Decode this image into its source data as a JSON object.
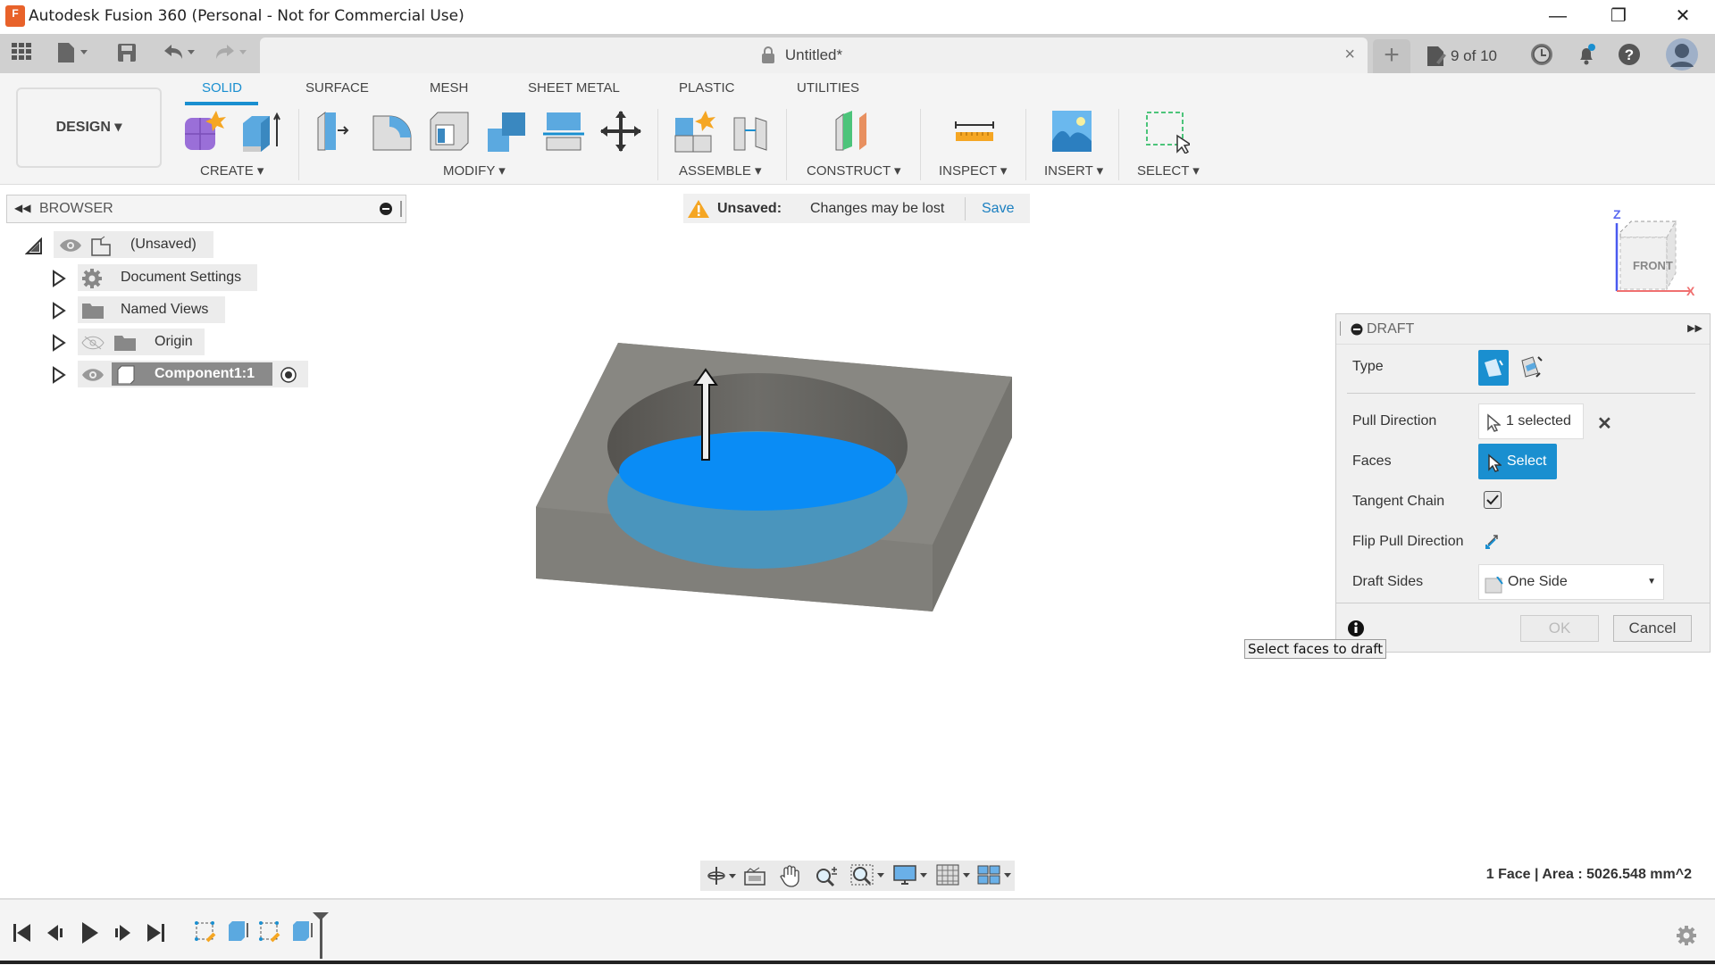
{
  "window": {
    "title": "Autodesk Fusion 360 (Personal - Not for Commercial Use)",
    "app_icon_letter": "F",
    "minimize": "—",
    "restore": "❐",
    "close": "✕"
  },
  "quick_access": {
    "document_tab_title": "Untitled*",
    "tab_close": "×",
    "new_tab": "+",
    "job_status": "9 of 10"
  },
  "ribbon": {
    "workspace": "DESIGN ▾",
    "tabs": [
      "SOLID",
      "SURFACE",
      "MESH",
      "SHEET METAL",
      "PLASTIC",
      "UTILITIES"
    ],
    "active_tab": "SOLID",
    "groups": [
      "CREATE ▾",
      "MODIFY ▾",
      "ASSEMBLE ▾",
      "CONSTRUCT ▾",
      "INSPECT ▾",
      "INSERT ▾",
      "SELECT ▾"
    ]
  },
  "browser": {
    "title": "BROWSER",
    "items": [
      {
        "label": "(Unsaved)",
        "icon": "component-root-icon"
      },
      {
        "label": "Document Settings",
        "icon": "gear-icon"
      },
      {
        "label": "Named Views",
        "icon": "folder-icon"
      },
      {
        "label": "Origin",
        "icon": "folder-icon"
      },
      {
        "label": "Component1:1",
        "icon": "component-icon"
      }
    ]
  },
  "banner": {
    "status": "Unsaved:",
    "message": "Changes may be lost",
    "save_label": "Save"
  },
  "viewcube": {
    "face": "FRONT",
    "axis_z": "Z",
    "axis_x": "X"
  },
  "draft": {
    "title": "DRAFT",
    "type_label": "Type",
    "pull_direction_label": "Pull Direction",
    "pull_direction_value": "1 selected",
    "faces_label": "Faces",
    "faces_button": "Select",
    "tangent_chain_label": "Tangent Chain",
    "tangent_chain_checked": true,
    "flip_label": "Flip Pull Direction",
    "draft_sides_label": "Draft Sides",
    "draft_sides_value": "One Side",
    "ok_label": "OK",
    "cancel_label": "Cancel",
    "tooltip": "Select faces to draft"
  },
  "status": {
    "selection_info": "1 Face | Area : 5026.548 mm^2"
  },
  "colors": {
    "accent": "#1a8fd0",
    "selected_face": "#0a8cf5",
    "model_gray": "#85847f",
    "warning": "#f5a623"
  }
}
